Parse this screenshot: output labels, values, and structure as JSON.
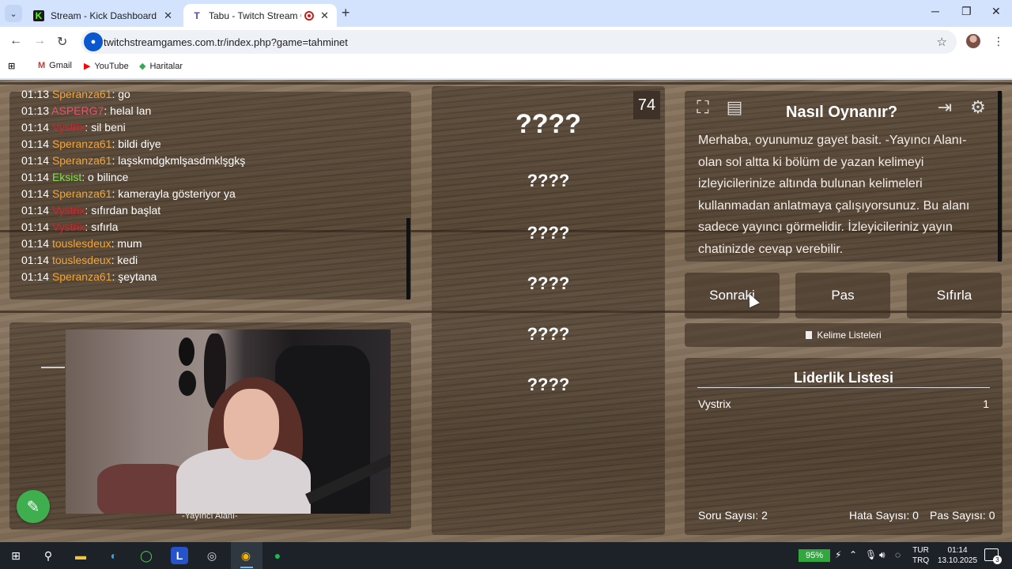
{
  "browser": {
    "tabs": [
      {
        "title": "Stream - Kick Dashboard",
        "favicon": "kick-icon"
      },
      {
        "title": "Tabu - Twitch Stream Game",
        "favicon": "twitch-games-icon"
      }
    ],
    "url": "twitchstreamgames.com.tr/index.php?game=tahminet",
    "bookmarks": [
      {
        "label": "Gmail",
        "icon": "gmail-icon",
        "color": "#d93025"
      },
      {
        "label": "YouTube",
        "icon": "youtube-icon",
        "color": "#ff0000"
      },
      {
        "label": "Haritalar",
        "icon": "maps-icon",
        "color": "#34a853"
      }
    ]
  },
  "chat": {
    "messages": [
      {
        "time": "01:13",
        "user": "Speranza61",
        "text": ": go",
        "color": "#f4a533"
      },
      {
        "time": "01:13",
        "user": "ASPERG7",
        "text": ": helal lan",
        "color": "#e0566b"
      },
      {
        "time": "01:14",
        "user": "Vystrix",
        "text": ": sil beni",
        "color": "#d9202e"
      },
      {
        "time": "01:14",
        "user": "Speranza61",
        "text": ": bildi diye",
        "color": "#f4a533"
      },
      {
        "time": "01:14",
        "user": "Speranza61",
        "text": ": laşskmdgkmlşasdmklşgkş",
        "color": "#f4a533"
      },
      {
        "time": "01:14",
        "user": "Eksist",
        "text": ": o bilince",
        "color": "#7fe04d"
      },
      {
        "time": "01:14",
        "user": "Speranza61",
        "text": ": kamerayla gösteriyor ya",
        "color": "#f4a533"
      },
      {
        "time": "01:14",
        "user": "Vystrix",
        "text": ": sıfırdan başlat",
        "color": "#d9202e"
      },
      {
        "time": "01:14",
        "user": "Vystrix",
        "text": ": sıfırla",
        "color": "#d9202e"
      },
      {
        "time": "01:14",
        "user": "touslesdeux",
        "text": ": mum",
        "color": "#f4a533"
      },
      {
        "time": "01:14",
        "user": "touslesdeux",
        "text": ": kedi",
        "color": "#f4a533"
      },
      {
        "time": "01:14",
        "user": "Speranza61",
        "text": ": şeytana",
        "color": "#f4a533"
      }
    ]
  },
  "streamer": {
    "label": "-Yayıncı Alanı-"
  },
  "game": {
    "timer": "74",
    "main_word": "????",
    "taboo_words": [
      "????",
      "????",
      "????",
      "????",
      "????"
    ]
  },
  "rules": {
    "title": "Nasıl Oynanır?",
    "text": "Merhaba, oyunumuz gayet basit. -Yayıncı Alanı- olan sol altta ki bölüm de yazan kelimeyi izleyicilerinize altında bulunan kelimeleri kullanmadan anlatmaya çalışıyorsunuz. Bu alanı sadece yayıncı görmelidir. İzleyicileriniz yayın chatinizde cevap verebilir."
  },
  "actions": {
    "next": "Sonraki",
    "pass": "Pas",
    "reset": "Sıfırla",
    "word_lists": "Kelime Listeleri"
  },
  "leaderboard": {
    "title": "Liderlik Listesi",
    "rows": [
      {
        "name": "Vystrix",
        "score": "1"
      }
    ],
    "stats": {
      "questions": "Soru Sayısı: 2",
      "errors": "Hata Sayısı: 0",
      "passes": "Pas Sayısı: 0"
    }
  },
  "taskbar": {
    "battery": "95%",
    "lang_top": "TUR",
    "lang_bottom": "TRQ",
    "time": "01:14",
    "date": "13.10.2025",
    "notifications": "3"
  }
}
